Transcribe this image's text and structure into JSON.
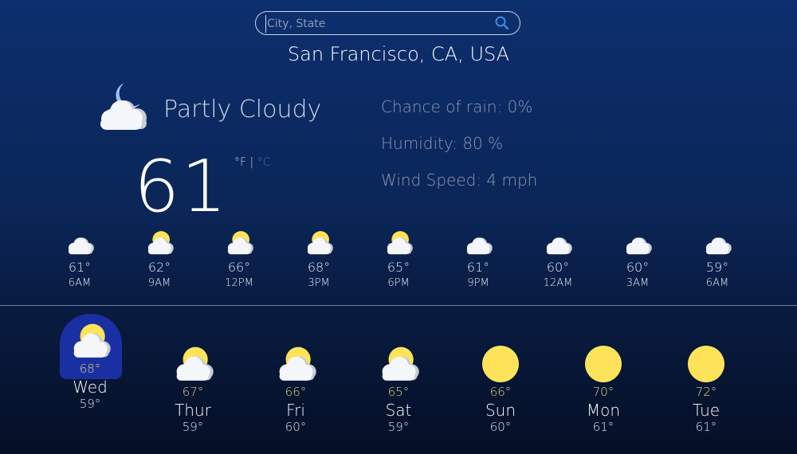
{
  "search": {
    "placeholder": "City, State",
    "value": ""
  },
  "location": "San Francisco, CA, USA",
  "current": {
    "icon": "partly-cloudy-night-icon",
    "condition": "Partly Cloudy",
    "temp": "61",
    "unit_f": "°F",
    "unit_sep": " | ",
    "unit_c": "°C",
    "selected_unit": "F"
  },
  "details": {
    "rain": "Chance of rain: 0%",
    "humidity": "Humidity: 80 %",
    "wind": "Wind Speed: 4 mph"
  },
  "hourly": [
    {
      "time": "6AM",
      "temp": "61°",
      "icon": "moon-cloud-icon"
    },
    {
      "time": "9AM",
      "temp": "62°",
      "icon": "sun-cloud-icon"
    },
    {
      "time": "12PM",
      "temp": "66°",
      "icon": "sun-cloud-icon"
    },
    {
      "time": "3PM",
      "temp": "68°",
      "icon": "sun-cloud-icon"
    },
    {
      "time": "6PM",
      "temp": "65°",
      "icon": "sun-cloud-icon"
    },
    {
      "time": "9PM",
      "temp": "61°",
      "icon": "moon-cloud-icon"
    },
    {
      "time": "12AM",
      "temp": "60°",
      "icon": "moon-cloud-icon"
    },
    {
      "time": "3AM",
      "temp": "60°",
      "icon": "moon-cloud-icon"
    },
    {
      "time": "6AM",
      "temp": "59°",
      "icon": "moon-cloud-icon"
    }
  ],
  "daily": [
    {
      "day": "Wed",
      "high": "68°",
      "low": "59°",
      "icon": "sun-cloud-icon",
      "selected": true
    },
    {
      "day": "Thur",
      "high": "67°",
      "low": "59°",
      "icon": "sun-cloud-icon"
    },
    {
      "day": "Fri",
      "high": "66°",
      "low": "60°",
      "icon": "sun-cloud-icon"
    },
    {
      "day": "Sat",
      "high": "65°",
      "low": "59°",
      "icon": "sun-cloud-icon"
    },
    {
      "day": "Sun",
      "high": "66°",
      "low": "60°",
      "icon": "sun-icon"
    },
    {
      "day": "Mon",
      "high": "70°",
      "low": "61°",
      "icon": "sun-icon"
    },
    {
      "day": "Tue",
      "high": "72°",
      "low": "61°",
      "icon": "sun-icon"
    }
  ],
  "colors": {
    "sun": "#fde35a",
    "cloud": "#f4f6fa",
    "moon": "#9fc0f5",
    "accent": "#3f7bd9",
    "selected_day": "#1a2fa1",
    "high_temp": "#e8d67a"
  }
}
